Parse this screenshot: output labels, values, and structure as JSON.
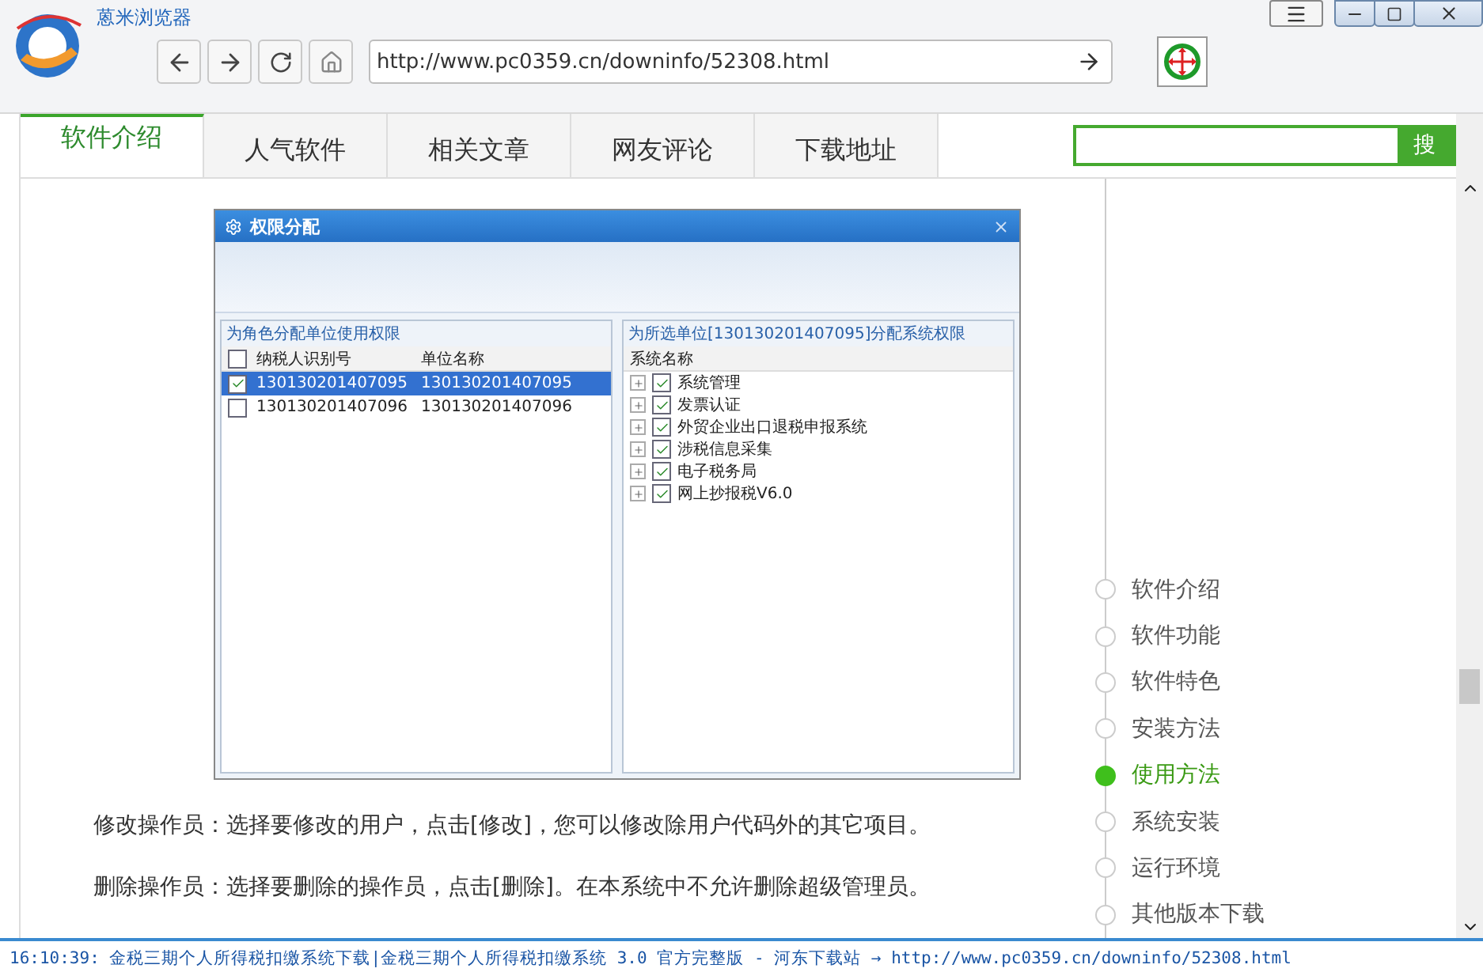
{
  "browser": {
    "title": "蒽米浏览器",
    "url": "http://www.pc0359.cn/downinfo/52308.html"
  },
  "tabs": [
    {
      "label": "软件介绍",
      "selected": true
    },
    {
      "label": "人气软件",
      "selected": false
    },
    {
      "label": "相关文章",
      "selected": false
    },
    {
      "label": "网友评论",
      "selected": false
    },
    {
      "label": "下载地址",
      "selected": false
    }
  ],
  "search": {
    "button": "搜"
  },
  "dialog": {
    "title": "权限分配",
    "left_group": {
      "title": "为角色分配单位使用权限",
      "select_all_checked": false,
      "columns": [
        "纳税人识别号",
        "单位名称"
      ],
      "rows": [
        {
          "checked": true,
          "selected": true,
          "cells": [
            "130130201407095",
            "130130201407095"
          ]
        },
        {
          "checked": false,
          "selected": false,
          "cells": [
            "130130201407096",
            "130130201407096"
          ]
        }
      ]
    },
    "right_group": {
      "title": "为所选单位[130130201407095]分配系统权限",
      "column": "系统名称",
      "items": [
        {
          "label": "系统管理",
          "checked": true
        },
        {
          "label": "发票认证",
          "checked": true
        },
        {
          "label": "外贸企业出口退税申报系统",
          "checked": true
        },
        {
          "label": "涉税信息采集",
          "checked": true
        },
        {
          "label": "电子税务局",
          "checked": true
        },
        {
          "label": "网上抄报税V6.0",
          "checked": true
        }
      ]
    }
  },
  "paragraphs": [
    "修改操作员：选择要修改的用户，点击[修改]，您可以修改除用户代码外的其它项目。",
    "删除操作员：选择要删除的操作员，点击[删除]。在本系统中不允许删除超级管理员。"
  ],
  "toc": [
    {
      "label": "软件介绍",
      "selected": false
    },
    {
      "label": "软件功能",
      "selected": false
    },
    {
      "label": "软件特色",
      "selected": false
    },
    {
      "label": "安装方法",
      "selected": false
    },
    {
      "label": "使用方法",
      "selected": true
    },
    {
      "label": "系统安装",
      "selected": false
    },
    {
      "label": "运行环境",
      "selected": false
    },
    {
      "label": "其他版本下载",
      "selected": false
    }
  ],
  "status_bar": "16:10:39: 金税三期个人所得税扣缴系统下载|金税三期个人所得税扣缴系统 3.0 官方完整版 - 河东下载站 → http://www.pc0359.cn/downinfo/52308.html"
}
